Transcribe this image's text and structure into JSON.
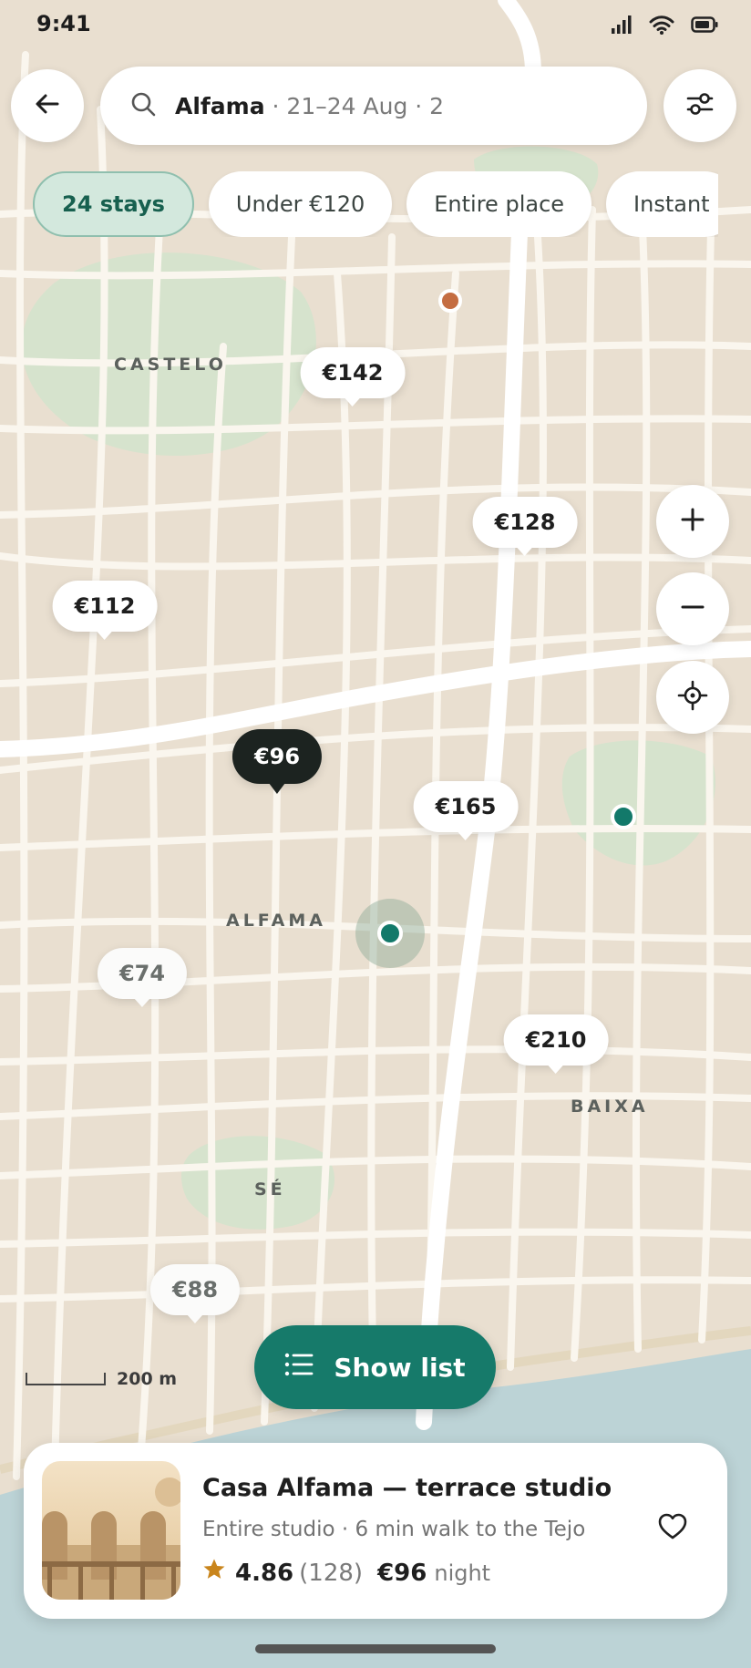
{
  "status_bar": {
    "time": "9:41",
    "icons": [
      "signal-icon",
      "wifi-icon",
      "battery-icon"
    ]
  },
  "top_bar": {
    "back_icon": "arrow-left-icon",
    "search": {
      "icon": "search-icon",
      "location": "Alfama",
      "details": " · 21–24 Aug · 2"
    },
    "filter_icon": "sliders-icon"
  },
  "chips": [
    {
      "label": "24 stays",
      "active": true
    },
    {
      "label": "Under €120",
      "active": false
    },
    {
      "label": "Entire place",
      "active": false
    },
    {
      "label": "Instant",
      "active": false
    }
  ],
  "map": {
    "area_labels": [
      "CASTELO",
      "ALFAMA",
      "BAIXA",
      "SÉ"
    ],
    "price_markers": [
      "€142",
      "€128",
      "€112",
      "€96",
      "€165",
      "€74",
      "€210",
      "€88"
    ],
    "selected_marker": "€96",
    "scale": {
      "label": "200 m"
    },
    "controls": [
      "zoom-in-icon",
      "zoom-out-icon",
      "locate-icon"
    ],
    "colors": {
      "land": "#e9dfd0",
      "road": "#faf6ee",
      "park": "#d6e3cd",
      "water": "#bcd3d6",
      "accent": "#167a6a"
    }
  },
  "show_list": {
    "label": "Show list",
    "icon": "list-icon"
  },
  "listing": {
    "title": "Casa Alfama — terrace studio",
    "subtitle": "Entire studio · 6 min walk to the Tejo",
    "rating": "4.86",
    "reviews": "(128)",
    "price": "€96",
    "price_unit": "night",
    "star_icon": "star-icon",
    "favorite_icon": "heart-icon"
  }
}
